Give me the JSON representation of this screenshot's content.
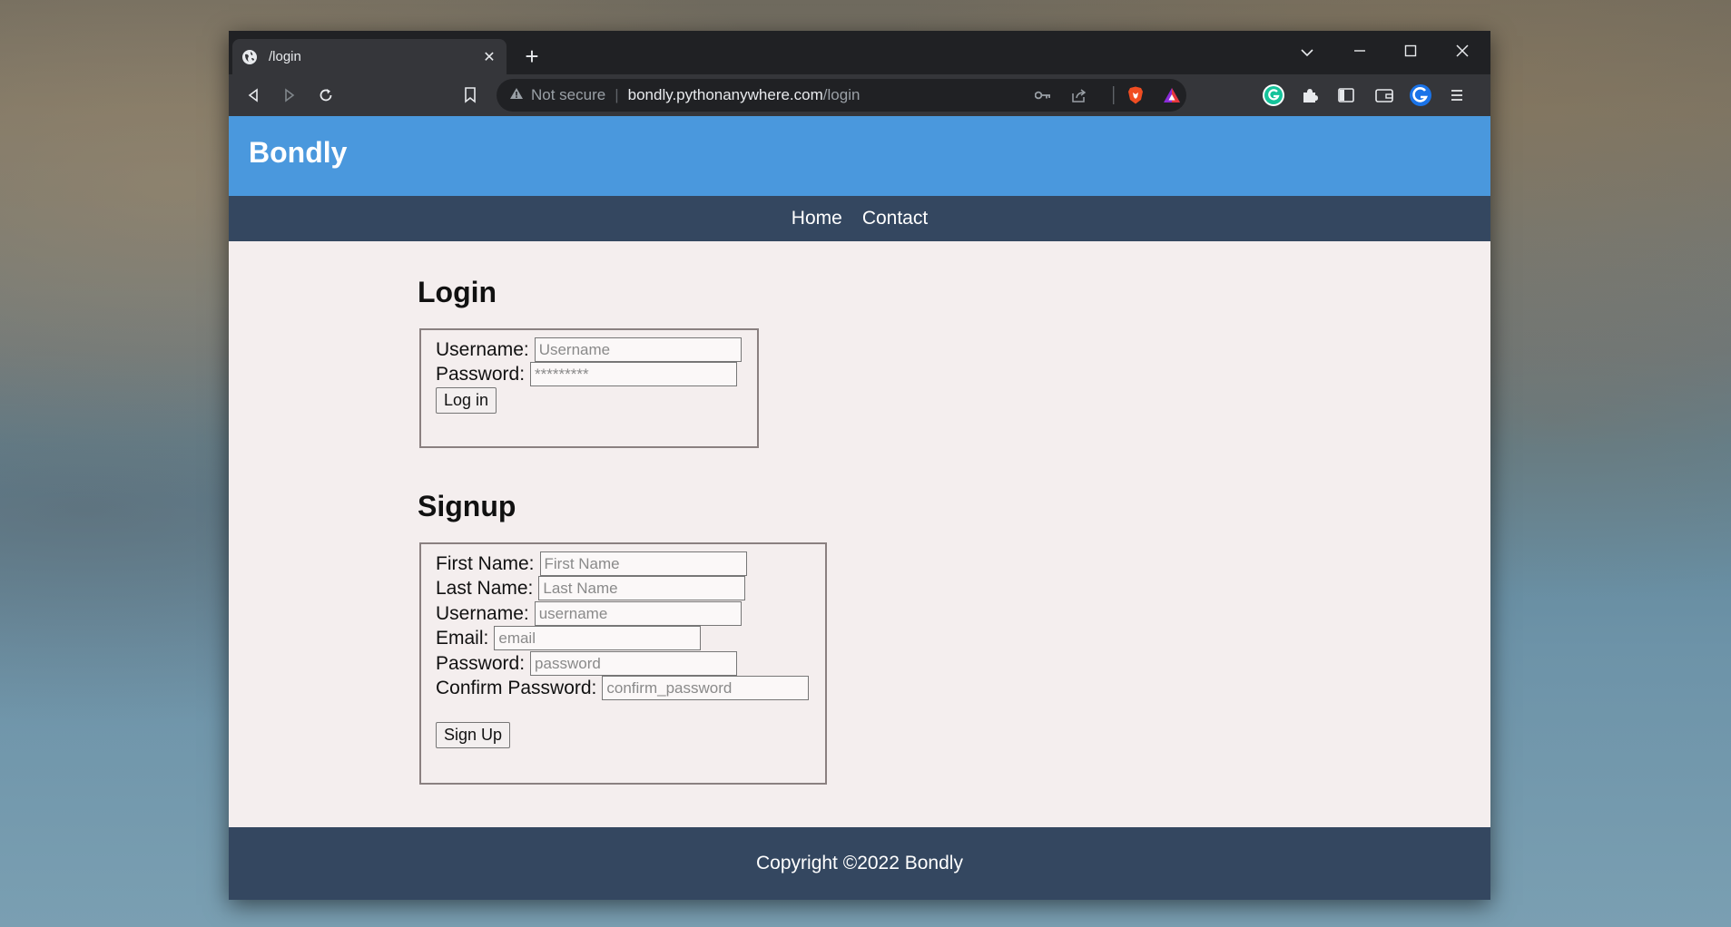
{
  "browser": {
    "tab_title": "/login",
    "new_tab": "+",
    "close_tab": "✕",
    "address": {
      "security": "Not secure",
      "host": "bondly.pythonanywhere.com",
      "path": "/login"
    }
  },
  "site": {
    "brand": "Bondly",
    "nav": [
      {
        "label": "Home"
      },
      {
        "label": "Contact"
      }
    ],
    "footer": "Copyright ©2022 Bondly"
  },
  "login": {
    "heading": "Login",
    "username_label": "Username:",
    "username_placeholder": "Username",
    "password_label": "Password:",
    "password_placeholder": "*********",
    "submit": "Log in"
  },
  "signup": {
    "heading": "Signup",
    "first_name_label": "First Name:",
    "first_name_placeholder": "First Name",
    "last_name_label": "Last Name:",
    "last_name_placeholder": "Last Name",
    "username_label": "Username:",
    "username_placeholder": "username",
    "email_label": "Email:",
    "email_placeholder": "email",
    "password_label": "Password:",
    "password_placeholder": "password",
    "confirm_label": "Confirm Password:",
    "confirm_placeholder": "confirm_password",
    "submit": "Sign Up"
  },
  "colors": {
    "header": "#4a98dd",
    "nav": "#344760",
    "page_bg": "#f4eeee"
  }
}
